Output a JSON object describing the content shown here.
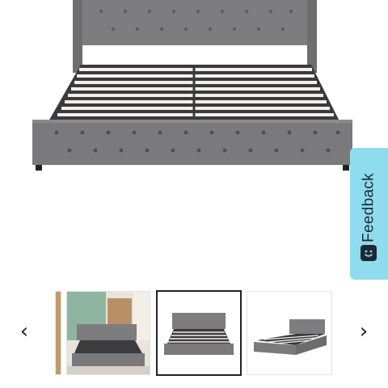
{
  "feedback": {
    "label": "Feedback",
    "icon": "smiley-icon"
  },
  "gallery": {
    "prev_icon": "‹",
    "next_icon": "›",
    "thumbnails": [
      {
        "name": "thumbnail-partial",
        "selected": false
      },
      {
        "name": "thumbnail-bedroom-scene",
        "selected": false
      },
      {
        "name": "thumbnail-bed-front",
        "selected": true
      },
      {
        "name": "thumbnail-bed-angled",
        "selected": false
      }
    ]
  },
  "colors": {
    "upholstery": "#7a7a7d",
    "slats": "#f1f0ea",
    "feedback_bg": "#8fdcee",
    "selected_border": "#222222"
  }
}
